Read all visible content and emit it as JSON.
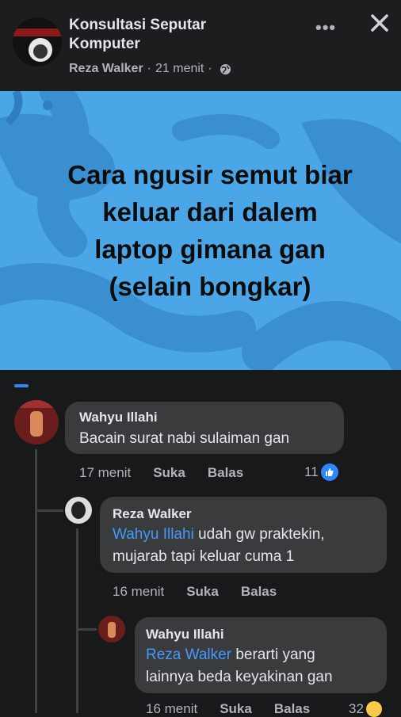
{
  "header": {
    "group_name": "Konsultasi Seputar Komputer",
    "poster": "Reza Walker",
    "time": "21 menit",
    "separator": "·",
    "more_label": "•••"
  },
  "post": {
    "image_text": "Cara ngusir semut biar\nkeluar dari dalem\nlaptop  gimana gan\n(selain bongkar)"
  },
  "comments": [
    {
      "author": "Wahyu Illahi",
      "text": "Bacain surat nabi sulaiman gan",
      "time": "17 menit",
      "like_label": "Suka",
      "reply_label": "Balas",
      "reaction_count": "11"
    },
    {
      "author": "Reza Walker",
      "mention": "Wahyu Illahi",
      "text_line1": "udah gw praktekin,",
      "text_line2": "mujarab tapi keluar cuma 1",
      "time": "16 menit",
      "like_label": "Suka",
      "reply_label": "Balas"
    },
    {
      "author": "Wahyu Illahi",
      "mention": "Reza Walker",
      "text_line1": "berarti yang",
      "text_line2": "lainnya beda keyakinan gan",
      "time": "16 menit",
      "like_label": "Suka",
      "reply_label": "Balas",
      "reaction_count": "32"
    }
  ],
  "colors": {
    "background": "#18191a",
    "bubble": "#3a3b3c",
    "mention": "#4599ff",
    "image_bg": "#4aa6e6",
    "like_blue": "#2d88ff"
  },
  "icons": [
    "globe-icon",
    "more-icon",
    "close-icon",
    "like-icon",
    "haha-icon"
  ]
}
